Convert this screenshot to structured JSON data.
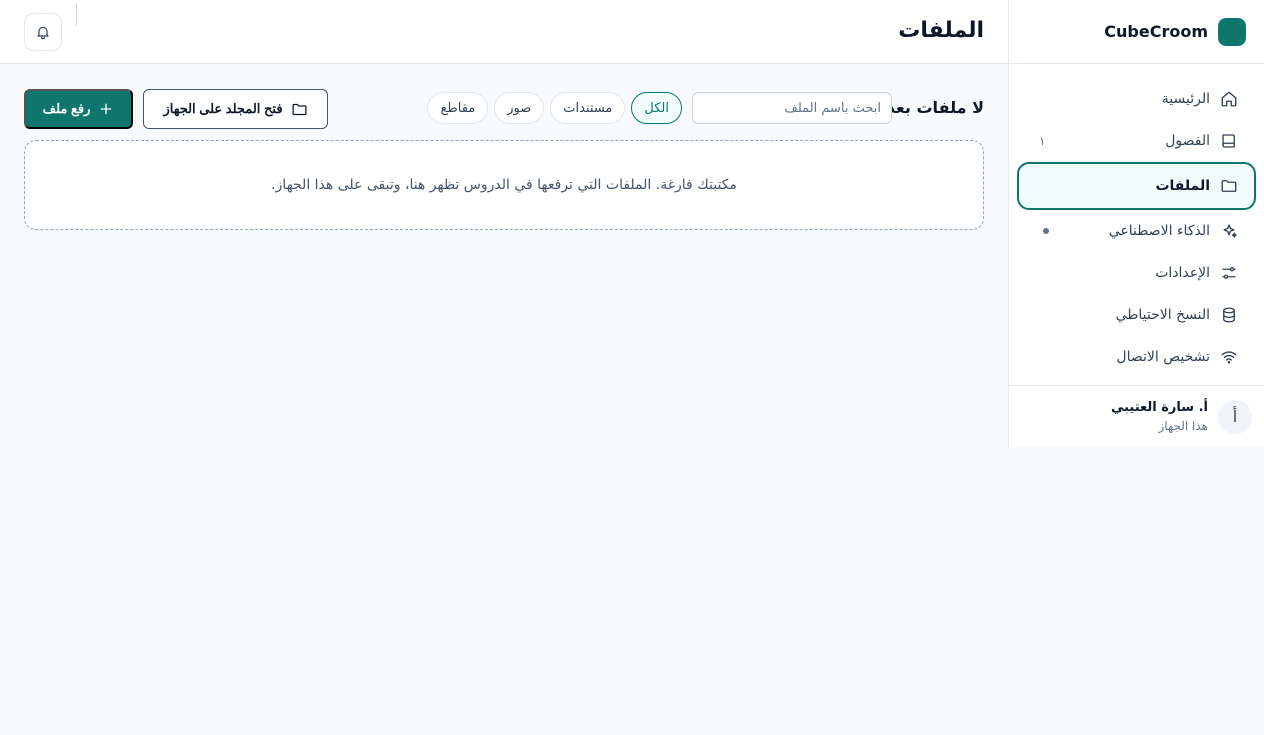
{
  "brand": {
    "name": "CubeCroom"
  },
  "sidebar": {
    "items": [
      {
        "label": "الرئيسية",
        "icon": "home-icon"
      },
      {
        "label": "الفصول",
        "icon": "book-icon",
        "badge": "١"
      },
      {
        "label": "الملفات",
        "icon": "folder-icon",
        "active": true
      },
      {
        "label": "الذكاء الاصطناعي",
        "icon": "sparkles-icon",
        "status_dot": true
      },
      {
        "label": "الإعدادات",
        "icon": "sliders-icon"
      },
      {
        "label": "النسخ الاحتياطي",
        "icon": "database-icon"
      },
      {
        "label": "تشخيص الاتصال",
        "icon": "wifi-icon"
      }
    ],
    "user": {
      "initial": "أ",
      "name": "أ. سارة العتيبي",
      "device": "هذا الجهاز"
    }
  },
  "header": {
    "title": "الملفات",
    "bell_icon": "bell-icon"
  },
  "toolbar": {
    "count_label": "لا ملفات بعد",
    "search_placeholder": "ابحث باسم الملف",
    "filters": [
      {
        "label": "الكل",
        "active": true
      },
      {
        "label": "مستندات"
      },
      {
        "label": "صور"
      },
      {
        "label": "مقاطع"
      }
    ],
    "open_folder_label": "فتح المجلد على الجهاز",
    "upload_label": "رفع ملف"
  },
  "empty_state": {
    "message": "مكتبتك فارغة. الملفات التي ترفعها في الدروس تظهر هنا، وتبقى على هذا الجهاز."
  },
  "colors": {
    "accent": "#0f766e",
    "accent_soft": "#f0fdfa",
    "border": "#e2e8f0",
    "background": "#f8fafc"
  }
}
